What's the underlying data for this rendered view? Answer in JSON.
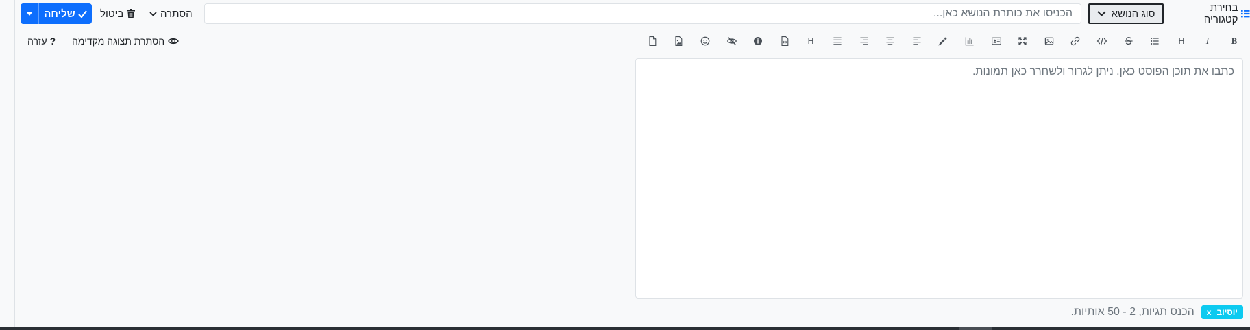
{
  "header": {
    "category_label": "בחירת קטגוריה",
    "topic_type_label": "סוג הנושא",
    "title_placeholder": "הכניסו את כותרת הנושא כאן...",
    "hide_label": "הסתרה",
    "cancel_label": "ביטול",
    "send_label": "שליחה",
    "send_color": "#0d6efd"
  },
  "toolbar": {
    "buttons": [
      "bold-icon",
      "italic-icon",
      "heading-icon",
      "bulleted-list-icon",
      "strikethrough-icon",
      "code-icon",
      "link-icon",
      "image-icon",
      "fullscreen-icon",
      "id-card-icon",
      "chart-icon",
      "eyedropper-icon",
      "align-left-icon",
      "align-center-icon",
      "align-right-icon",
      "align-justify-icon",
      "heading-alt-icon",
      "file-code-icon",
      "info-icon",
      "hidden-icon",
      "emoji-icon",
      "file-image-icon",
      "file-icon"
    ],
    "preview_label": "הסתרת תצוגה מקדימה",
    "help_label": "עזרה"
  },
  "editor": {
    "placeholder": "כתבו את תוכן הפוסט כאן. ניתן לגרור ולשחרר כאן תמונות."
  },
  "tags": {
    "badge_label": "יוסיוב",
    "badge_remove": "x",
    "placeholder": "הכנס תגיות, 2 - 50 אותיות.",
    "badge_color": "#0dcaf0"
  }
}
